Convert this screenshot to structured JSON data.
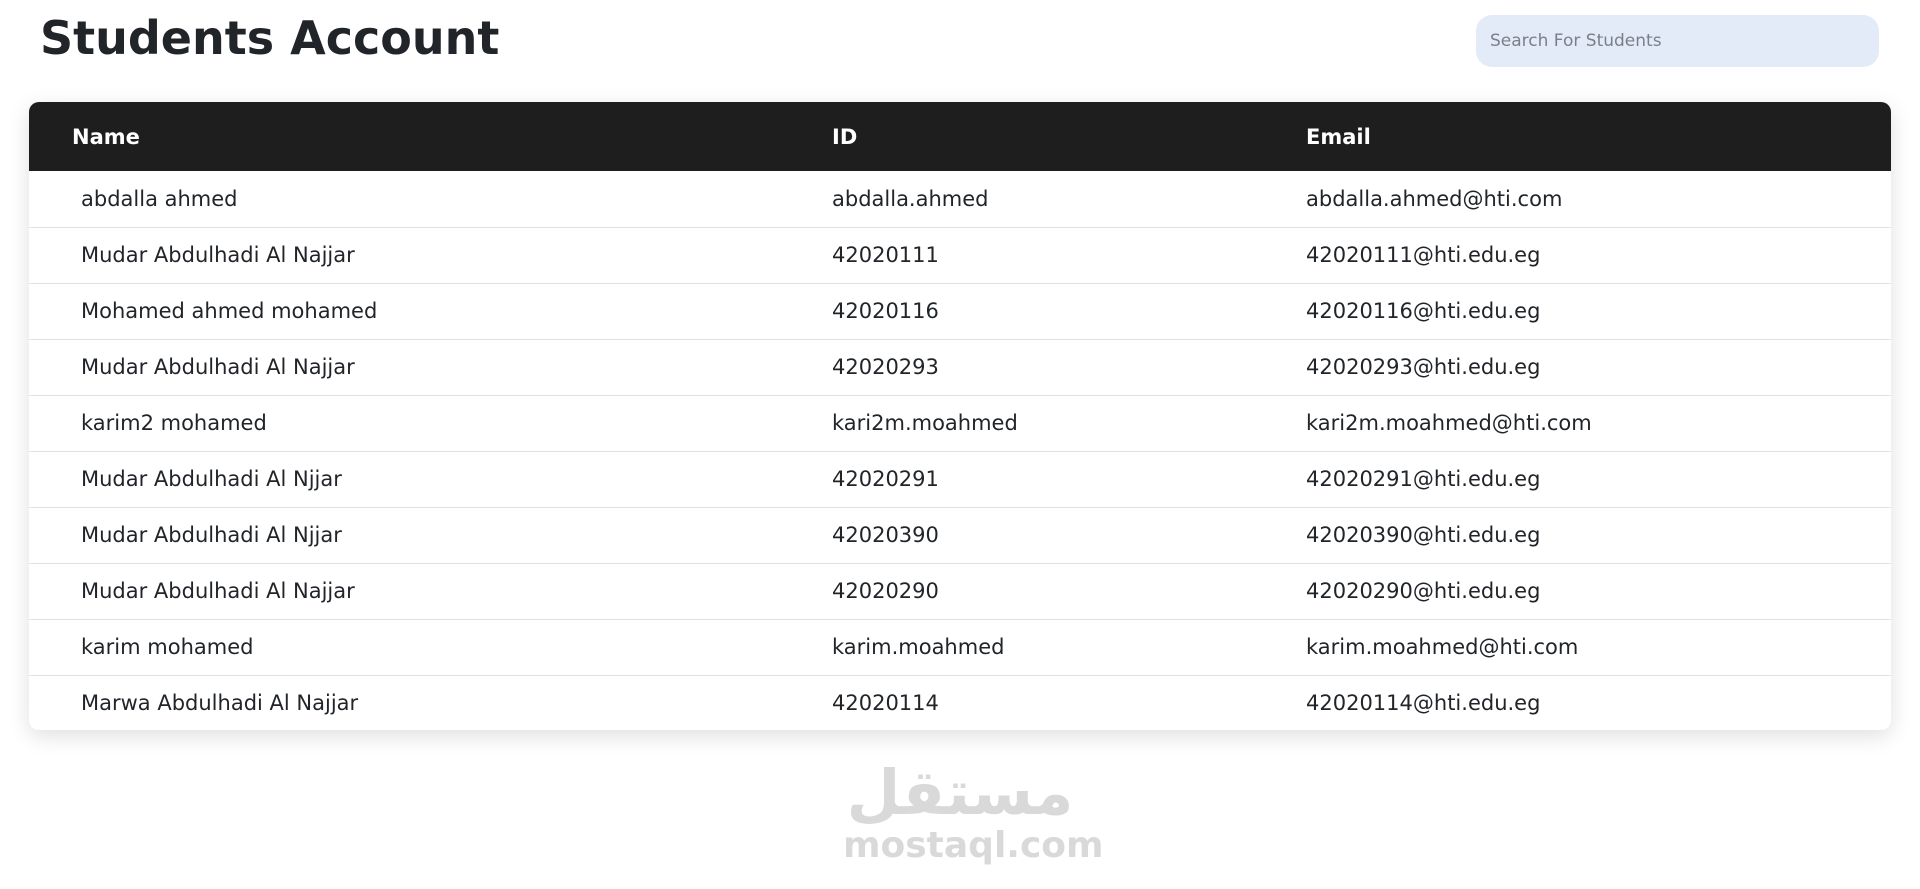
{
  "header": {
    "title": "Students Account"
  },
  "search": {
    "placeholder": "Search For Students",
    "value": ""
  },
  "table": {
    "columns": [
      "Name",
      "ID",
      "Email"
    ],
    "rows": [
      {
        "name": "abdalla ahmed",
        "id": "abdalla.ahmed",
        "email": "abdalla.ahmed@hti.com"
      },
      {
        "name": "Mudar Abdulhadi Al Najjar",
        "id": "42020111",
        "email": "42020111@hti.edu.eg"
      },
      {
        "name": "Mohamed ahmed mohamed",
        "id": "42020116",
        "email": "42020116@hti.edu.eg"
      },
      {
        "name": "Mudar Abdulhadi Al Najjar",
        "id": "42020293",
        "email": "42020293@hti.edu.eg"
      },
      {
        "name": "karim2 mohamed",
        "id": "kari2m.moahmed",
        "email": "kari2m.moahmed@hti.com"
      },
      {
        "name": "Mudar Abdulhadi Al Njjar",
        "id": "42020291",
        "email": "42020291@hti.edu.eg"
      },
      {
        "name": "Mudar Abdulhadi Al Njjar",
        "id": "42020390",
        "email": "42020390@hti.edu.eg"
      },
      {
        "name": "Mudar Abdulhadi Al Najjar",
        "id": "42020290",
        "email": "42020290@hti.edu.eg"
      },
      {
        "name": "karim mohamed",
        "id": "karim.moahmed",
        "email": "karim.moahmed@hti.com"
      },
      {
        "name": "Marwa Abdulhadi Al Najjar",
        "id": "42020114",
        "email": "42020114@hti.edu.eg"
      }
    ]
  },
  "watermark": {
    "logo": "مستقل",
    "text": "mostaql.com"
  },
  "colors": {
    "header_bg": "#1e1e1e",
    "search_bg": "#e3ebf8",
    "row_border": "#dee2e6"
  }
}
